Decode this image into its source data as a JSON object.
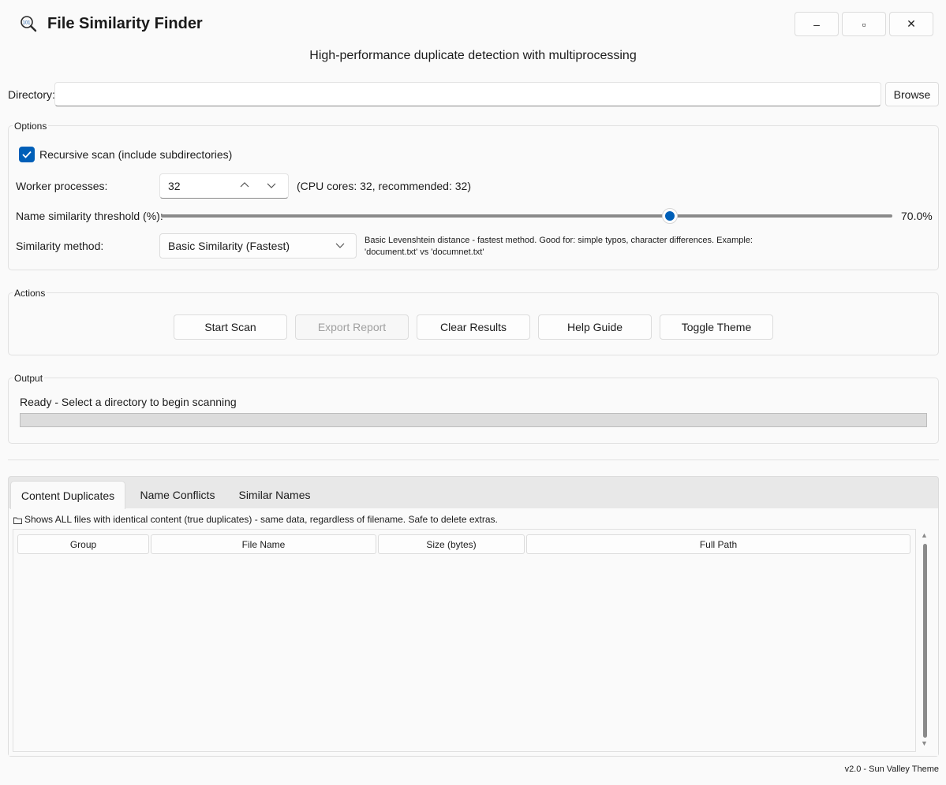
{
  "app": {
    "title": "File Similarity Finder",
    "subtitle": "High-performance duplicate detection with multiprocessing",
    "icon": "magnifier-1011-icon",
    "window_controls": {
      "minimize": "–",
      "maximize": "▫",
      "close": "✕"
    }
  },
  "directory": {
    "label": "Directory:",
    "value": "",
    "placeholder": "",
    "browse_label": "Browse"
  },
  "options": {
    "group_label": "Options",
    "recursive": {
      "label": "Recursive scan (include subdirectories)",
      "checked": true
    },
    "workers": {
      "label": "Worker processes:",
      "value": "32",
      "info": "(CPU cores: 32, recommended: 32)"
    },
    "threshold": {
      "label": "Name similarity threshold (%):",
      "value": 70.0,
      "display": "70.0%",
      "min": 0,
      "max": 100
    },
    "method": {
      "label": "Similarity method:",
      "value": "Basic Similarity (Fastest)",
      "description": "Basic Levenshtein distance - fastest method. Good for: simple typos, character differences. Example: 'document.txt' vs 'documnet.txt'"
    }
  },
  "actions": {
    "group_label": "Actions",
    "buttons": [
      {
        "label": "Start Scan",
        "enabled": true
      },
      {
        "label": "Export Report",
        "enabled": false
      },
      {
        "label": "Clear Results",
        "enabled": true
      },
      {
        "label": "Help Guide",
        "enabled": true
      },
      {
        "label": "Toggle Theme",
        "enabled": true
      }
    ]
  },
  "output": {
    "group_label": "Output",
    "status": "Ready - Select a directory to begin scanning",
    "progress": 0
  },
  "results": {
    "tabs": [
      {
        "label": "Content Duplicates",
        "active": true
      },
      {
        "label": "Name Conflicts",
        "active": false
      },
      {
        "label": "Similar Names",
        "active": false
      }
    ],
    "description": "Shows ALL files with identical content (true duplicates) - same data, regardless of filename. Safe to delete extras.",
    "columns": [
      "Group",
      "File Name",
      "Size (bytes)",
      "Full Path"
    ],
    "rows": []
  },
  "footer": "v2.0 - Sun Valley Theme",
  "colors": {
    "accent": "#005fb8",
    "background": "#fafafa"
  }
}
